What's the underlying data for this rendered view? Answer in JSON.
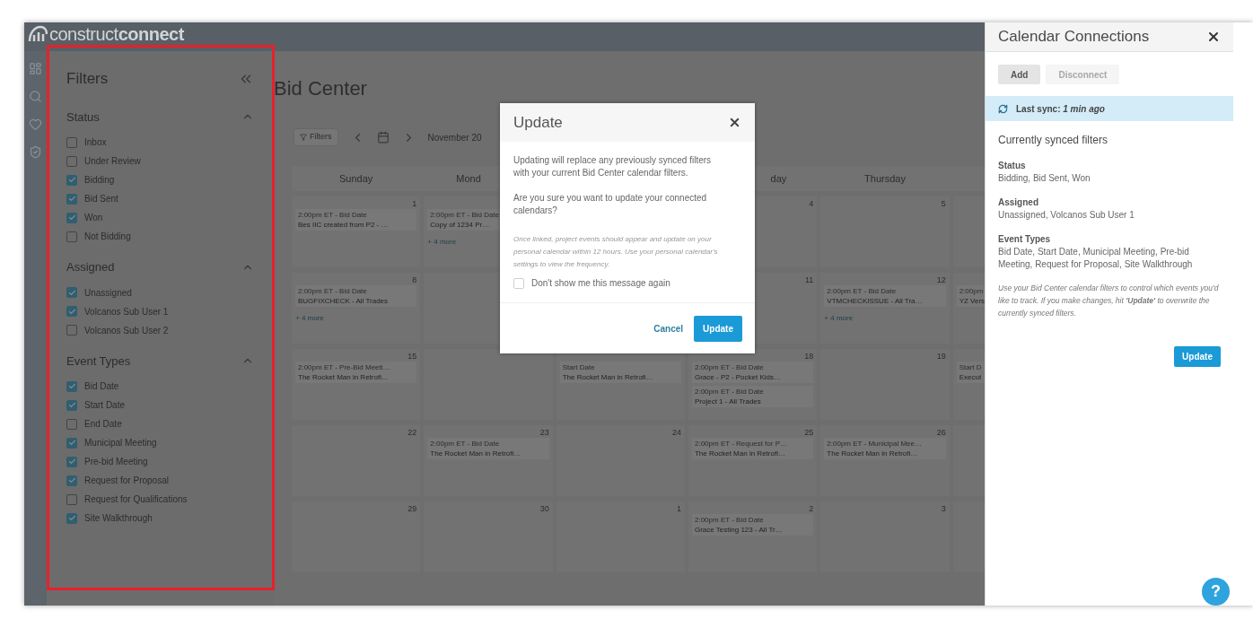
{
  "header": {
    "logo": "construct**connect**"
  },
  "filters": {
    "title": "Filters",
    "sections": [
      {
        "title": "Status",
        "expanded": true,
        "items": [
          {
            "label": "Inbox",
            "checked": false
          },
          {
            "label": "Under Review",
            "checked": false
          },
          {
            "label": "Bidding",
            "checked": true
          },
          {
            "label": "Bid Sent",
            "checked": true
          },
          {
            "label": "Won",
            "checked": true
          },
          {
            "label": "Not Bidding",
            "checked": false
          }
        ]
      },
      {
        "title": "Assigned",
        "expanded": true,
        "items": [
          {
            "label": "Unassigned",
            "checked": true
          },
          {
            "label": "Volcanos Sub User 1",
            "checked": true
          },
          {
            "label": "Volcanos Sub User 2",
            "checked": false
          }
        ]
      },
      {
        "title": "Event Types",
        "expanded": true,
        "items": [
          {
            "label": "Bid Date",
            "checked": true
          },
          {
            "label": "Start Date",
            "checked": true
          },
          {
            "label": "End Date",
            "checked": false
          },
          {
            "label": "Municipal Meeting",
            "checked": true
          },
          {
            "label": "Pre-bid Meeting",
            "checked": true
          },
          {
            "label": "Request for Proposal",
            "checked": true
          },
          {
            "label": "Request for Qualifications",
            "checked": false
          },
          {
            "label": "Site Walkthrough",
            "checked": true
          }
        ]
      }
    ]
  },
  "page": {
    "title": "Bid Center",
    "filters_button": "Filters",
    "month": "November 20"
  },
  "calendar": {
    "weekdays": {
      "sunday": "Sunday",
      "monday": "Mond",
      "wednesday": "day",
      "thursday": "Thursday"
    },
    "weeks": [
      {
        "sunday": {
          "day": "1",
          "events": [
            {
              "time": "2:00pm ET - Bid Date",
              "title": "Bes IIC created from P2 - …"
            }
          ]
        },
        "monday": {
          "events": [
            {
              "time": "2:00pm ET - Bid Date",
              "title": "Copy of 1234 Pr…"
            }
          ],
          "more": "+ 4 more"
        },
        "wednesday": {
          "day": "4"
        },
        "thursday": {
          "day": "5"
        }
      },
      {
        "sunday": {
          "day": "8",
          "events": [
            {
              "time": "2:00pm ET - Bid Date",
              "title": "BUGFIXCHECK - All Trades"
            }
          ],
          "more": "+ 4 more"
        },
        "wednesday": {
          "day": "11"
        },
        "thursday": {
          "day": "12",
          "events": [
            {
              "time": "2:00pm ET - Bid Date",
              "title": "VTMCHECKISSUE - All Tra…"
            }
          ],
          "more": "+ 4 more"
        },
        "friday": {
          "events": [
            {
              "time": "2:00pm",
              "title": "YZ Vers"
            }
          ]
        }
      },
      {
        "sunday": {
          "day": "15",
          "events": [
            {
              "time": "2:00pm ET - Pre-Bid Meeti…",
              "title": "The Rocket Man in Retrofi…"
            }
          ]
        },
        "tuesday": {
          "events": [
            {
              "time": "Start Date",
              "title": "The Rocket Man in Retrofi…"
            }
          ]
        },
        "wednesday": {
          "day": "18",
          "events": [
            {
              "time": "2:00pm ET - Bid Date",
              "title": "Grace - P2 - Pocket Kids…"
            },
            {
              "time": "2:00pm ET - Bid Date",
              "title": "Project 1 - All Trades"
            }
          ]
        },
        "thursday": {
          "day": "19"
        },
        "friday": {
          "events": [
            {
              "time": "Start D",
              "title": "Execut"
            }
          ]
        }
      },
      {
        "sunday": {
          "day": "22"
        },
        "monday": {
          "day": "23",
          "events": [
            {
              "time": "2:00pm ET - Bid Date",
              "title": "The Rocket Man in Retrofi…"
            }
          ]
        },
        "tuesday": {
          "day": "24"
        },
        "wednesday": {
          "day": "25",
          "events": [
            {
              "time": "2:00pm ET - Request for P…",
              "title": "The Rocket Man in Retrofi…"
            }
          ]
        },
        "thursday": {
          "day": "26",
          "events": [
            {
              "time": "2:00pm ET - Municipal Mee…",
              "title": "The Rocket Man in Retrofi…"
            }
          ]
        }
      },
      {
        "sunday": {
          "day": "29"
        },
        "monday": {
          "day": "30"
        },
        "tuesday": {
          "day": "1"
        },
        "wednesday": {
          "day": "2",
          "events": [
            {
              "time": "2:00pm ET - Bid Date",
              "title": "Grace Testing 123 - All Tr…"
            }
          ]
        },
        "thursday": {
          "day": "3"
        }
      }
    ]
  },
  "modal": {
    "title": "Update",
    "paragraphs": [
      "Updating will replace any previously synced filters with your current Bid Center calendar filters.",
      "Are you sure you want to update your connected calendars?"
    ],
    "note": "Once linked, project events should appear and update on your personal calendar within 12 hours. Use your personal calendar's settings to view the frequency.",
    "checkbox": {
      "label": "Don't show me this message again",
      "checked": false
    },
    "cancel": "Cancel",
    "confirm": "Update"
  },
  "panel": {
    "title": "Calendar Connections",
    "buttons": [
      {
        "label": "Add",
        "disabled": false
      },
      {
        "label": "Disconnect",
        "disabled": true
      }
    ],
    "sync": "Last sync: *1 min ago*",
    "heading": "Currently synced filters",
    "groups": [
      {
        "title": "Status",
        "value": "Bidding, Bid Sent, Won"
      },
      {
        "title": "Assigned",
        "value": "Unassigned, Volcanos Sub User 1"
      },
      {
        "title": "Event Types",
        "value": "Bid Date, Start Date, Municipal Meeting, Pre-bid Meeting, Request for Proposal, Site Walkthrough"
      }
    ],
    "note": "Use your Bid Center calendar filters to control which events you'd like to track. If you make changes, hit **'Update'** to overwrite the currently synced filters.",
    "update": "Update",
    "help": "?"
  }
}
